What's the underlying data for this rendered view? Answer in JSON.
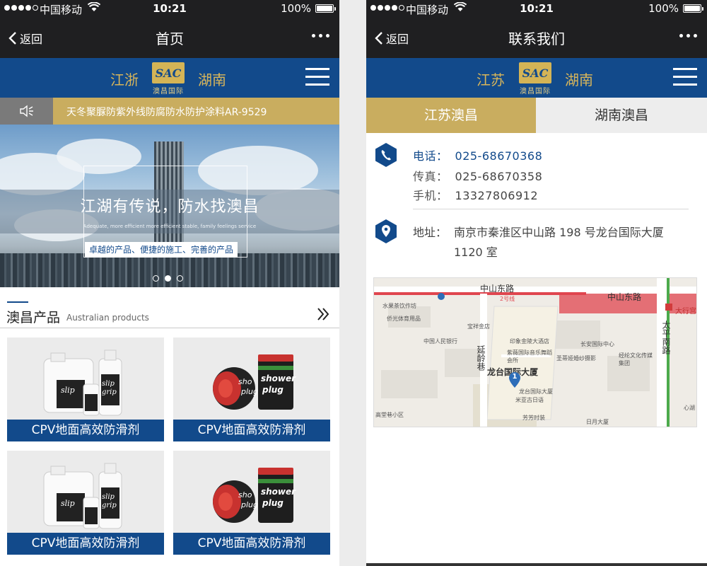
{
  "status": {
    "carrier": "中国移动",
    "time": "10:21",
    "battery": "100%"
  },
  "left": {
    "nav": {
      "back": "返回",
      "title": "首页"
    },
    "header": {
      "region_left": "江浙",
      "region_right": "湖南",
      "logo_text": "SAC",
      "logo_cn": "澳昌国际"
    },
    "ticker": "天冬聚脲防紫外线防腐防水防护涂料AR-9529",
    "banner": {
      "headline": "江湖有传说，防水找澳昌",
      "subline": "Adequate, more efficient more efficient stable, family feelings service",
      "slogan": "卓越的产品、便捷的施工、完善的产品",
      "slides": 3,
      "active_slide": 2
    },
    "section": {
      "title_cn": "澳昌产品",
      "title_en": "Australian products"
    },
    "products": [
      {
        "label": "CPV地面高效防滑剂",
        "image": "slip-grip-bottles"
      },
      {
        "label": "CPV地面高效防滑剂",
        "image": "shower-plug-cans"
      },
      {
        "label": "CPV地面高效防滑剂",
        "image": "slip-grip-bottles"
      },
      {
        "label": "CPV地面高效防滑剂",
        "image": "shower-plug-cans"
      }
    ]
  },
  "right": {
    "nav": {
      "back": "返回",
      "title": "联系我们"
    },
    "header": {
      "region_left": "江苏",
      "region_right": "湖南",
      "logo_text": "SAC",
      "logo_cn": "澳昌国际"
    },
    "tabs": {
      "active": "江苏澳昌",
      "inactive": "湖南澳昌"
    },
    "contact": {
      "phone_label": "电话：",
      "phone": "025-68670368",
      "fax_label": "传真：",
      "fax": "025-68670358",
      "mobile_label": "手机：",
      "mobile": "13327806912",
      "address_label": "地址：",
      "address": "南京市秦淮区中山路 198 号龙台国际大厦 1120 室"
    },
    "map": {
      "roads": [
        "中山东路",
        "中山东路",
        "延龄巷",
        "太平南路"
      ],
      "line_label": "2号线",
      "building": "龙台国际大厦",
      "marker": "1",
      "pois": [
        "水果茶饮作坊",
        "侨光体育用品",
        "宝祥金店",
        "中国人民银行",
        "印象金陵大酒店",
        "紫薇国际音乐舞蹈会所",
        "长安国际中心",
        "圣蒂娅婚纱摄影",
        "经纶文化传媒集团",
        "龙台国际大厦",
        "米亚古日语",
        "芳芳时装",
        "日月大厦",
        "大行宫",
        "心湖",
        "高堂巷小区"
      ],
      "colors": {
        "metro_red": "#e0464f",
        "green_line": "#4caa4c"
      }
    }
  },
  "colors": {
    "brand_blue": "#124a8b",
    "gold": "#c9ad5f",
    "nav_dark": "#1f1f21"
  }
}
